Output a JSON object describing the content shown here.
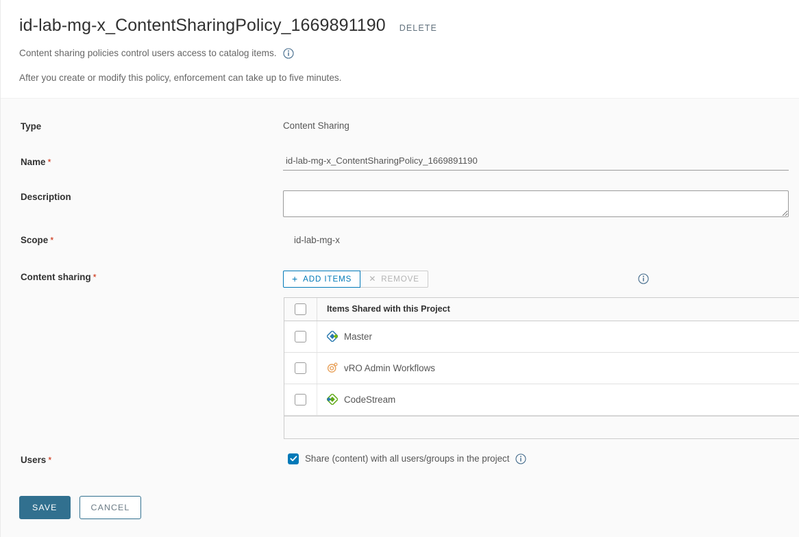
{
  "header": {
    "title": "id-lab-mg-x_ContentSharingPolicy_1669891190",
    "delete_label": "DELETE",
    "subtitle": "Content sharing policies control users access to catalog items.",
    "subtitle_info_icon": "info-icon",
    "note": "After you create or modify this policy, enforcement can take up to five minutes."
  },
  "form": {
    "type": {
      "label": "Type",
      "value": "Content Sharing"
    },
    "name": {
      "label": "Name",
      "required_marker": "*",
      "value": "id-lab-mg-x_ContentSharingPolicy_1669891190",
      "placeholder": ""
    },
    "description": {
      "label": "Description",
      "value": "",
      "placeholder": ""
    },
    "scope": {
      "label": "Scope",
      "required_marker": "*",
      "value": "id-lab-mg-x"
    },
    "content_sharing": {
      "label": "Content sharing",
      "required_marker": "*",
      "add_items_label": "ADD ITEMS",
      "add_items_icon": "plus-icon",
      "remove_label": "REMOVE",
      "remove_icon": "close-x-icon",
      "info_icon": "info-icon",
      "table": {
        "columns": [
          "",
          "Items Shared with this Project"
        ],
        "rows": [
          {
            "checked": false,
            "icon": "blueprint-diamond-icon",
            "icon_color": "#2a7ab0",
            "name": "Master"
          },
          {
            "checked": false,
            "icon": "vro-workflow-circle-icon",
            "icon_color": "#e8a25c",
            "name": "vRO Admin Workflows"
          },
          {
            "checked": false,
            "icon": "codestream-diamond-icon",
            "icon_color": "#60a917",
            "name": "CodeStream"
          }
        ]
      }
    },
    "users": {
      "label": "Users",
      "required_marker": "*",
      "checkbox_checked": true,
      "checkbox_label": "Share (content) with all users/groups in the project",
      "info_icon": "info-icon"
    }
  },
  "footer": {
    "save_label": "SAVE",
    "cancel_label": "CANCEL"
  },
  "colors": {
    "accent_blue": "#0079b8",
    "primary_button": "#31708f",
    "required_red": "#c92100",
    "page_background": "#fafafa",
    "header_background": "#ffffff"
  }
}
